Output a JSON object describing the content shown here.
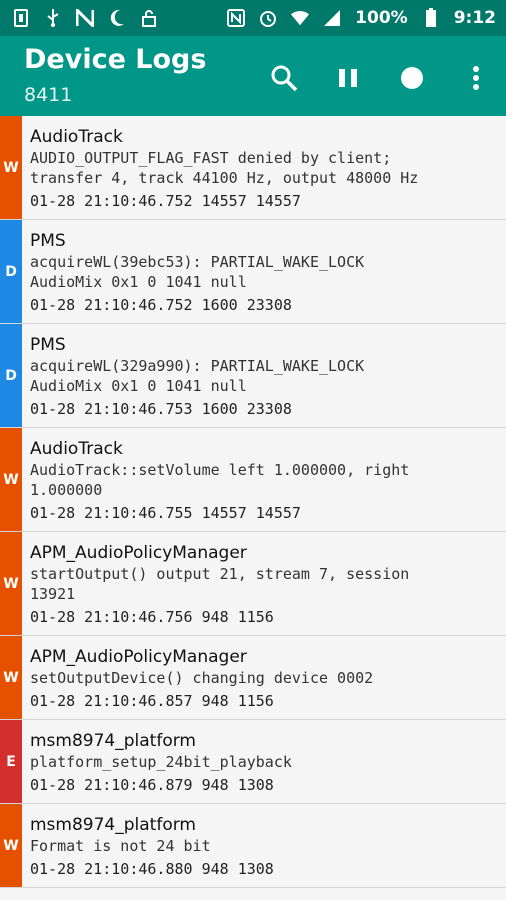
{
  "statusbar": {
    "battery": "100%",
    "time": "9:12"
  },
  "appbar": {
    "title": "Device Logs",
    "subtitle": "8411",
    "icons": [
      "search-icon",
      "pause-icon",
      "record-icon",
      "more-icon"
    ]
  },
  "colors": {
    "W": "#e65100",
    "D": "#1e88e5",
    "E": "#d32f2f"
  },
  "entries": [
    {
      "level": "W",
      "tag": "AudioTrack",
      "message": "AUDIO_OUTPUT_FLAG_FAST denied by client;\ntransfer 4, track 44100 Hz, output 48000 Hz",
      "meta": "01-28 21:10:46.752 14557 14557"
    },
    {
      "level": "D",
      "tag": "PMS",
      "message": "acquireWL(39ebc53): PARTIAL_WAKE_LOCK\nAudioMix 0x1 0 1041 null",
      "meta": "01-28 21:10:46.752 1600 23308"
    },
    {
      "level": "D",
      "tag": "PMS",
      "message": "acquireWL(329a990): PARTIAL_WAKE_LOCK\nAudioMix 0x1 0 1041 null",
      "meta": "01-28 21:10:46.753 1600 23308"
    },
    {
      "level": "W",
      "tag": "AudioTrack",
      "message": "AudioTrack::setVolume left 1.000000, right\n1.000000",
      "meta": "01-28 21:10:46.755 14557 14557"
    },
    {
      "level": "W",
      "tag": "APM_AudioPolicyManager",
      "message": "startOutput() output 21, stream 7, session\n13921",
      "meta": "01-28 21:10:46.756 948 1156"
    },
    {
      "level": "W",
      "tag": "APM_AudioPolicyManager",
      "message": "setOutputDevice() changing device 0002",
      "meta": "01-28 21:10:46.857 948 1156"
    },
    {
      "level": "E",
      "tag": "msm8974_platform",
      "message": "platform_setup_24bit_playback",
      "meta": "01-28 21:10:46.879 948 1308"
    },
    {
      "level": "W",
      "tag": "msm8974_platform",
      "message": "Format is not 24 bit",
      "meta": "01-28 21:10:46.880 948 1308"
    }
  ]
}
